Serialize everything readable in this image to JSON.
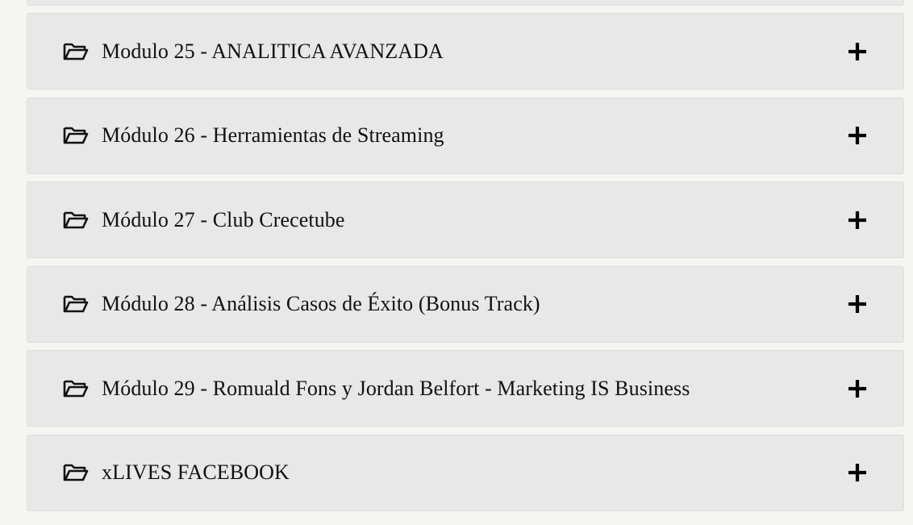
{
  "accordion": {
    "items": [
      {
        "label": "Modulo 25 - ANALITICA AVANZADA",
        "icon": "folder-open-icon",
        "toggle_icon": "plus-icon"
      },
      {
        "label": "Módulo 26 - Herramientas de Streaming",
        "icon": "folder-open-icon",
        "toggle_icon": "plus-icon"
      },
      {
        "label": "Módulo 27 - Club Crecetube",
        "icon": "folder-open-icon",
        "toggle_icon": "plus-icon"
      },
      {
        "label": "Módulo 28 - Análisis Casos de Éxito (Bonus Track)",
        "icon": "folder-open-icon",
        "toggle_icon": "plus-icon"
      },
      {
        "label": "Módulo 29 - Romuald Fons y Jordan Belfort - Marketing IS Business",
        "icon": "folder-open-icon",
        "toggle_icon": "plus-icon"
      },
      {
        "label": "xLIVES FACEBOOK",
        "icon": "folder-open-icon",
        "toggle_icon": "plus-icon"
      }
    ]
  },
  "colors": {
    "page_background": "#f5f5f2",
    "panel_background": "#e8e8e8",
    "panel_border": "#dcdcdc",
    "text": "#111111"
  }
}
